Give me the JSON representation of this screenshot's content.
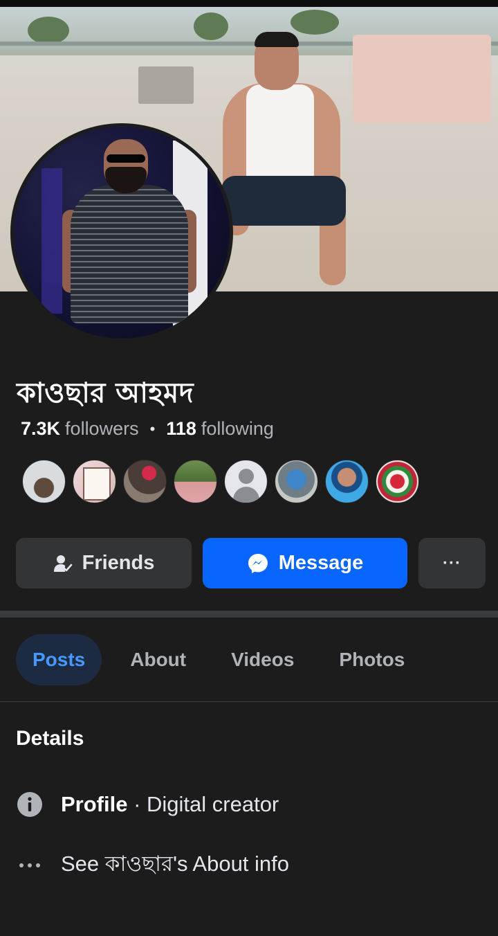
{
  "profile": {
    "name": "কাওছার আহমদ",
    "followers_count": "7.3K",
    "followers_label": "followers",
    "separator": "•",
    "following_count": "118",
    "following_label": "following"
  },
  "mutual_friends": [
    {
      "name": "friend-avatar-1"
    },
    {
      "name": "friend-avatar-2"
    },
    {
      "name": "friend-avatar-3"
    },
    {
      "name": "friend-avatar-4"
    },
    {
      "name": "friend-avatar-5-default"
    },
    {
      "name": "friend-avatar-6"
    },
    {
      "name": "friend-avatar-7"
    },
    {
      "name": "friend-avatar-8"
    }
  ],
  "actions": {
    "friends_label": "Friends",
    "friends_icon": "friends-check-icon",
    "message_label": "Message",
    "message_icon": "messenger-icon",
    "more_label": "···"
  },
  "tabs": [
    {
      "label": "Posts",
      "active": true
    },
    {
      "label": "About",
      "active": false
    },
    {
      "label": "Videos",
      "active": false
    },
    {
      "label": "Photos",
      "active": false
    }
  ],
  "details": {
    "title": "Details",
    "profile_bold": "Profile",
    "profile_rest": " · Digital creator",
    "about_link": "See কাওছার's About info"
  },
  "colors": {
    "background": "#1c1c1d",
    "primary": "#0866ff",
    "secondary_button": "#323436",
    "active_tab_bg": "#1c2b41",
    "active_tab_text": "#4599ff"
  }
}
